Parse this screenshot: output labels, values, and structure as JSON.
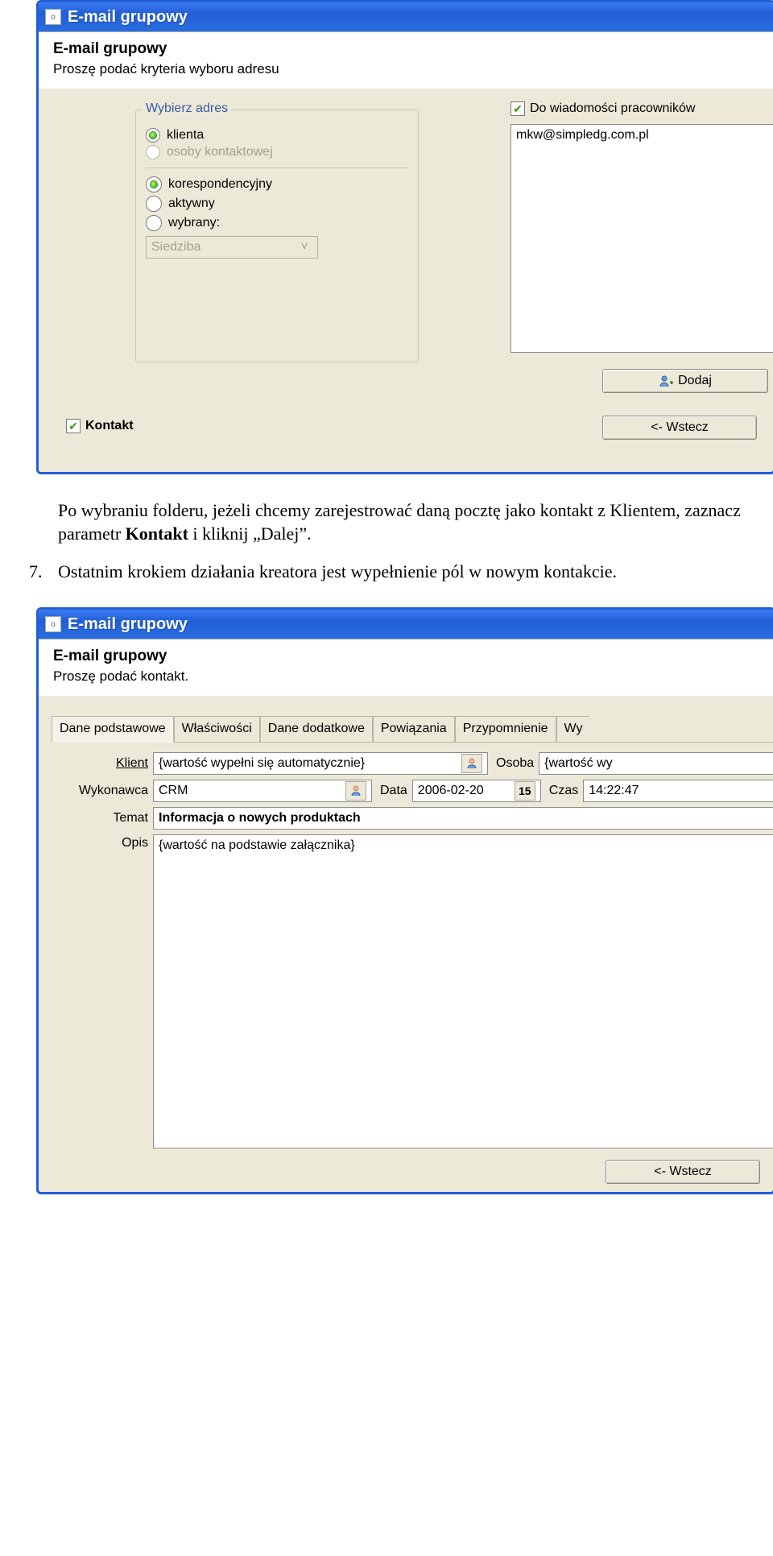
{
  "window1": {
    "title": "E-mail grupowy",
    "header_title": "E-mail grupowy",
    "header_sub": "Proszę podać kryteria wyboru adresu",
    "address_group_legend": "Wybierz adres",
    "radio_klienta": "klienta",
    "radio_osoby": "osoby kontaktowej",
    "radio_koresp": "korespondencyjny",
    "radio_aktywny": "aktywny",
    "radio_wybrany": "wybrany:",
    "select_siedziba": "Siedziba",
    "cc_label": "Do wiadomości pracowników",
    "cc_value": "mkw@simpledg.com.pl",
    "dodaj_label": "Dodaj",
    "kontakt_label": "Kontakt",
    "wstecz_label": "<- Wstecz"
  },
  "doc": {
    "para": "Po wybraniu folderu, jeżeli chcemy zarejestrować daną pocztę jako kontakt z Klientem, zaznacz parametr ",
    "bold1": "Kontakt",
    "para2": " i kliknij „Dalej”.",
    "num": "7.",
    "item7": "Ostatnim krokiem działania kreatora jest wypełnienie pól w nowym kontakcie."
  },
  "window2": {
    "title": "E-mail grupowy",
    "header_title": "E-mail grupowy",
    "header_sub": "Proszę podać kontakt.",
    "tabs": [
      "Dane podstawowe",
      "Właściwości",
      "Dane dodatkowe",
      "Powiązania",
      "Przypomnienie",
      "Wy"
    ],
    "lbl_klient": "Klient",
    "val_klient": "{wartość wypełni się automatycznie}",
    "lbl_osoba": "Osoba",
    "val_osoba": "{wartość wy",
    "lbl_wykonawca": "Wykonawca",
    "val_wykonawca": "CRM",
    "lbl_data": "Data",
    "val_data": "2006-02-20",
    "lbl_czas": "Czas",
    "val_czas": "14:22:47",
    "lbl_temat": "Temat",
    "val_temat": "Informacja o nowych produktach",
    "lbl_opis": "Opis",
    "val_opis": "{wartość na podstawie załącznika}",
    "wstecz_label": "<- Wstecz"
  }
}
